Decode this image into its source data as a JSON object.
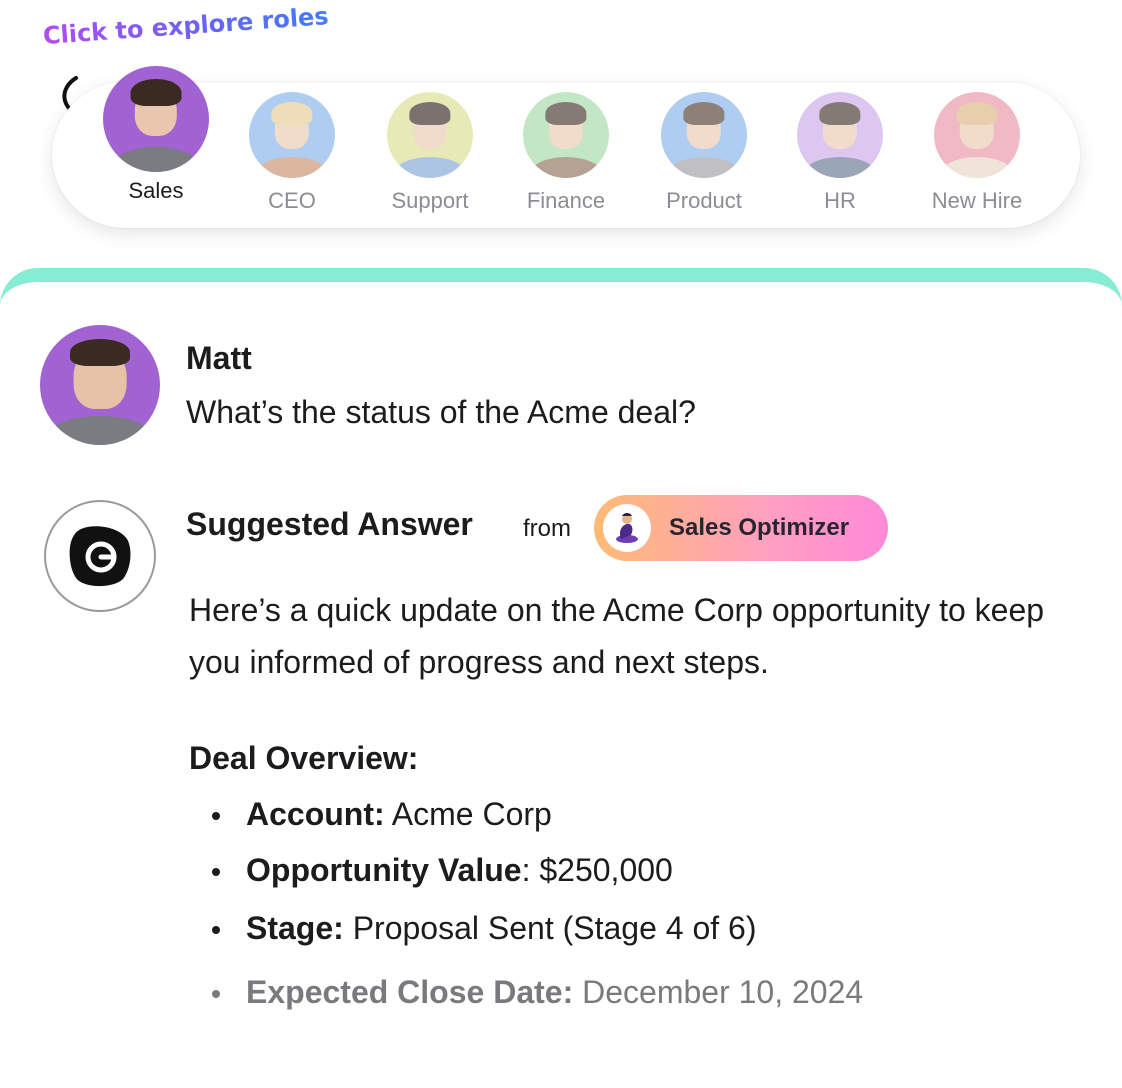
{
  "hint": {
    "text": "Click to explore roles"
  },
  "roles": [
    {
      "label": "Sales",
      "active": true
    },
    {
      "label": "CEO",
      "active": false
    },
    {
      "label": "Support",
      "active": false
    },
    {
      "label": "Finance",
      "active": false
    },
    {
      "label": "Product",
      "active": false
    },
    {
      "label": "HR",
      "active": false
    },
    {
      "label": "New Hire",
      "active": false
    }
  ],
  "chat": {
    "user": {
      "name": "Matt",
      "question": "What’s the status of the Acme deal?"
    },
    "answer": {
      "title": "Suggested Answer",
      "from_label": "from",
      "agent": "Sales Optimizer",
      "intro": "Here’s a quick update on the Acme Corp opportunity to keep you informed of progress and next steps.",
      "overview_title": "Deal Overview:",
      "items": [
        {
          "key": "Account:",
          "value": " Acme Corp"
        },
        {
          "key": "Opportunity Value",
          "value": ": $250,000"
        },
        {
          "key": "Stage:",
          "value": " Proposal Sent (Stage 4 of 6)"
        },
        {
          "key": "Expected Close Date:",
          "value": " December 10, 2024"
        }
      ]
    }
  },
  "colors": {
    "accent_bar": "#86ecd3",
    "sales_avatar_bg": "#a263d2",
    "agent_pill_start": "#fdbb74",
    "agent_pill_end": "#ff89d8"
  }
}
